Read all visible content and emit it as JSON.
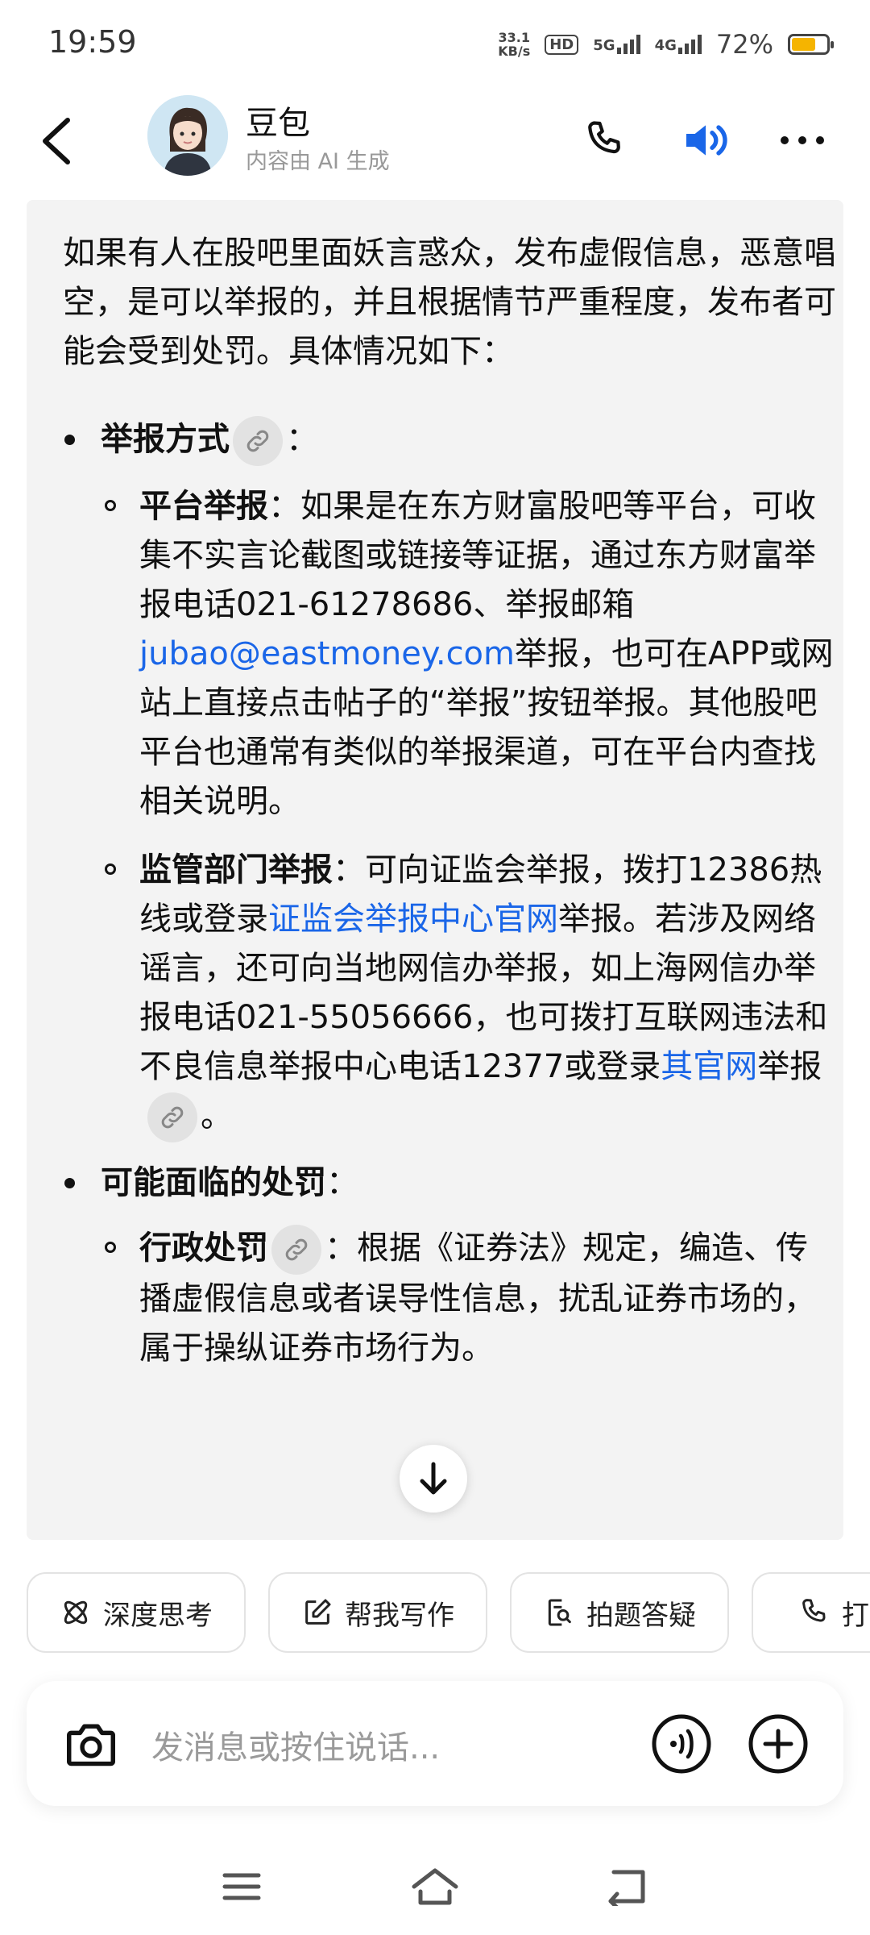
{
  "status": {
    "time": "19:59",
    "net_speed_value": "33.1",
    "net_speed_unit": "KB/s",
    "hd": "HD",
    "sig1": "5G",
    "sig2": "4G",
    "battery": "72%",
    "battery_level": 0.72,
    "battery_color": "#f5b400"
  },
  "header": {
    "name": "豆包",
    "subtitle": "内容由 AI 生成",
    "icons": [
      "back-icon",
      "phone-icon",
      "speaker-icon",
      "more-icon"
    ],
    "accent": "#1a66e8"
  },
  "message": {
    "intro": "如果有人在股吧里面妖言惑众，发布虚假信息，恶意唱空，是可以举报的，并且根据情节严重程度，发布者可能会受到处罚。具体情况如下：",
    "section1_title": "举报方式",
    "section1_suffix": "：",
    "platform_title": "平台举报",
    "platform_text1": "：如果是在东方财富股吧等平台，可收集不实言论截图或链接等证据，通过东方财富举报电话021-61278686、举报邮箱",
    "platform_email": "jubao@eastmoney.com",
    "platform_text2": "举报，也可在APP或网站上直接点击帖子的“举报”按钮举报。其他股吧平台也通常有类似的举报渠道，可在平台内查找相关说明。",
    "reg_title": "监管部门举报",
    "reg_text1": "：可向证监会举报，拨打12386热线或登录",
    "reg_link1": "证监会举报中心官网",
    "reg_text2": "举报。若涉及网络谣言，还可向当地网信办举报，如上海网信办举报电话021-55056666，也可拨打互联网违法和不良信息举报中心电话12377或登录",
    "reg_link2": "其官网",
    "reg_text3": "举报",
    "reg_end": "。",
    "section2_title": "可能面临的处罚",
    "section2_suffix": "：",
    "admin_title": "行政处罚",
    "admin_text": "：根据《证券法》规定，编造、传播虚假信息或者误导性信息，扰乱证券市场的，属于操纵证券市场行为。"
  },
  "chips": [
    {
      "label": "深度思考",
      "icon": "deep-think-icon"
    },
    {
      "label": "帮我写作",
      "icon": "write-icon"
    },
    {
      "label": "拍题答疑",
      "icon": "photo-question-icon"
    },
    {
      "label": "打电话",
      "icon": "phone-icon"
    }
  ],
  "input": {
    "placeholder": "发消息或按住说话...",
    "icons": [
      "camera-icon",
      "voice-icon",
      "plus-icon"
    ]
  },
  "navbar": {
    "icons": [
      "menu-icon",
      "home-icon",
      "back-nav-icon"
    ]
  }
}
